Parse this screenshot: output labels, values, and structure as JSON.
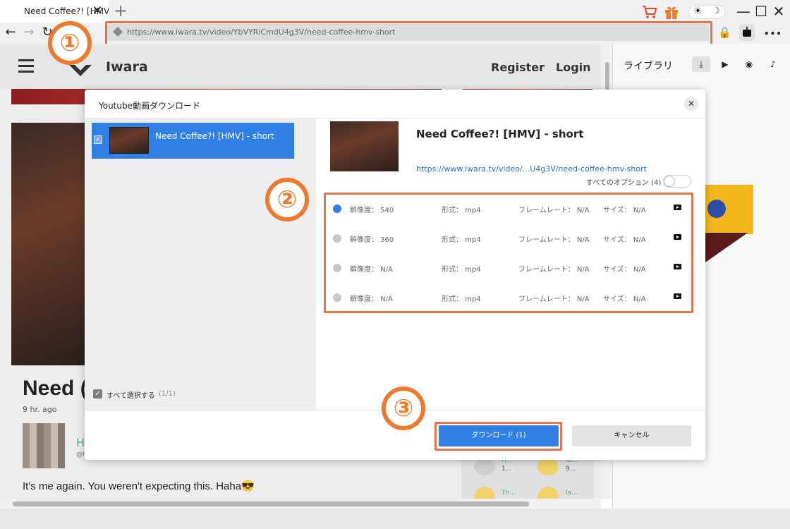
{
  "browser": {
    "tab_title": "Need Coffee?! [HMV",
    "new_tab_symbol": "+",
    "close_symbol": "✕",
    "url": "https://www.iwara.tv/video/YbVYRiCmdU4g3V/need-coffee-hmv-short",
    "icons": [
      "back-icon",
      "forward-icon",
      "reload-icon",
      "cart-icon",
      "gift-icon",
      "sun-icon",
      "moon-icon",
      "minimize-icon",
      "maximize-icon",
      "close-icon",
      "lock-icon",
      "download-icon",
      "more-icon"
    ]
  },
  "site": {
    "brand": "Iwara",
    "register": "Register",
    "login": "Login",
    "video_heading": "Need (",
    "posted_ago": "9 hr. ago",
    "commenter_initial": "H",
    "commenter_handle": "@h",
    "comment_text": "It's me again. You weren't expecting this. Haha😎",
    "side_users": [
      {
        "name": "H...",
        "sub": "1..."
      },
      {
        "name": "Gi...",
        "sub": "9..."
      },
      {
        "name": "Th...",
        "sub": ""
      },
      {
        "name": "la...",
        "sub": ""
      }
    ]
  },
  "library": {
    "title": "ライブラリ",
    "tabs": [
      "download-icon",
      "youtube-icon",
      "video-icon",
      "audio-icon"
    ]
  },
  "dialog": {
    "title": "Youtube動画ダウンロード",
    "close_symbol": "✕",
    "item_label": "Need Coffee?! [HMV] - short",
    "select_all": "すべて選択する",
    "select_count": "(1/1)",
    "video_title": "Need Coffee?! [HMV] - short",
    "video_url": "https://www.iwara.tv/video/...U4g3V/need-coffee-hmv-short",
    "all_options": "すべてのオプション (4)",
    "formats": [
      {
        "selected": true,
        "resolution": "解像度： 540",
        "format": "形式： mp4",
        "framerate": "フレームレート： N/A",
        "size": "サイズ： N/A"
      },
      {
        "selected": false,
        "resolution": "解像度： 360",
        "format": "形式： mp4",
        "framerate": "フレームレート： N/A",
        "size": "サイズ： N/A"
      },
      {
        "selected": false,
        "resolution": "解像度： N/A",
        "format": "形式： mp4",
        "framerate": "フレームレート： N/A",
        "size": "サイズ： N/A"
      },
      {
        "selected": false,
        "resolution": "解像度： N/A",
        "format": "形式： mp4",
        "framerate": "フレームレート： N/A",
        "size": "サイズ： N/A"
      }
    ],
    "download_button": "ダウンロード (1)",
    "cancel_button": "キャンセル"
  },
  "annotations": {
    "step1": "①",
    "step2": "②",
    "step3": "③",
    "highlight_color": "#e9744a",
    "accent_color": "#2f7fe5"
  }
}
